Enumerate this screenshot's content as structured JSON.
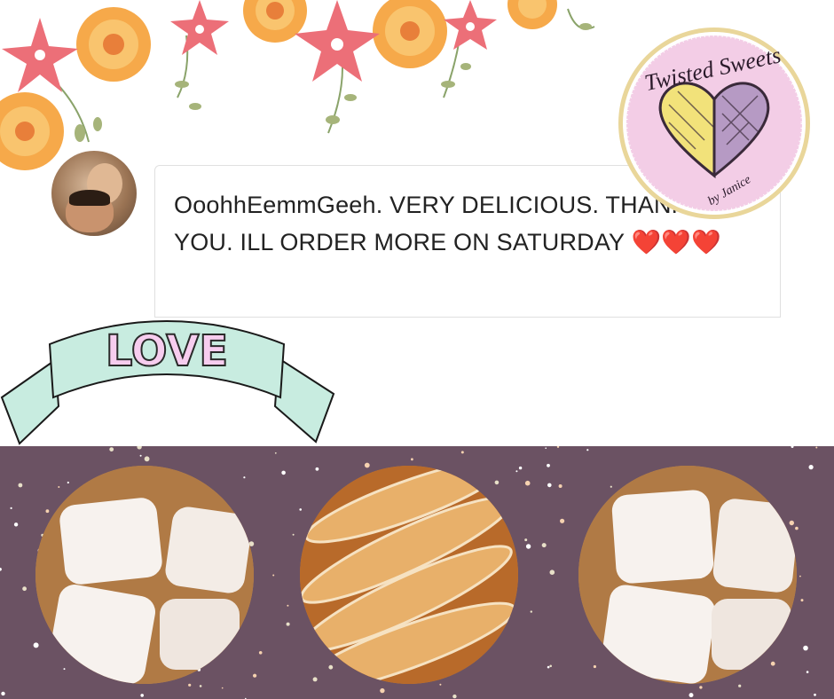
{
  "comment": {
    "text": "OoohhEemmGeeh. VERY DELICIOUS. THANK YOU. ILL ORDER MORE ON SATURDAY",
    "hearts": "❤️❤️❤️"
  },
  "ribbon": {
    "label": "LOVE"
  },
  "logo": {
    "brand": "Twisted Sweets",
    "tagline": "by Janice"
  },
  "colors": {
    "band": "#6b5263",
    "ribbon": "#c8ece0",
    "logo_bg": "#f3cde6",
    "heart": "#e0333f",
    "love_text": "#f7cdef"
  },
  "photos": [
    {
      "subject": "powdered-sugar-beignets"
    },
    {
      "subject": "twisted-sugar-donuts"
    },
    {
      "subject": "powdered-sugar-beignets"
    }
  ]
}
